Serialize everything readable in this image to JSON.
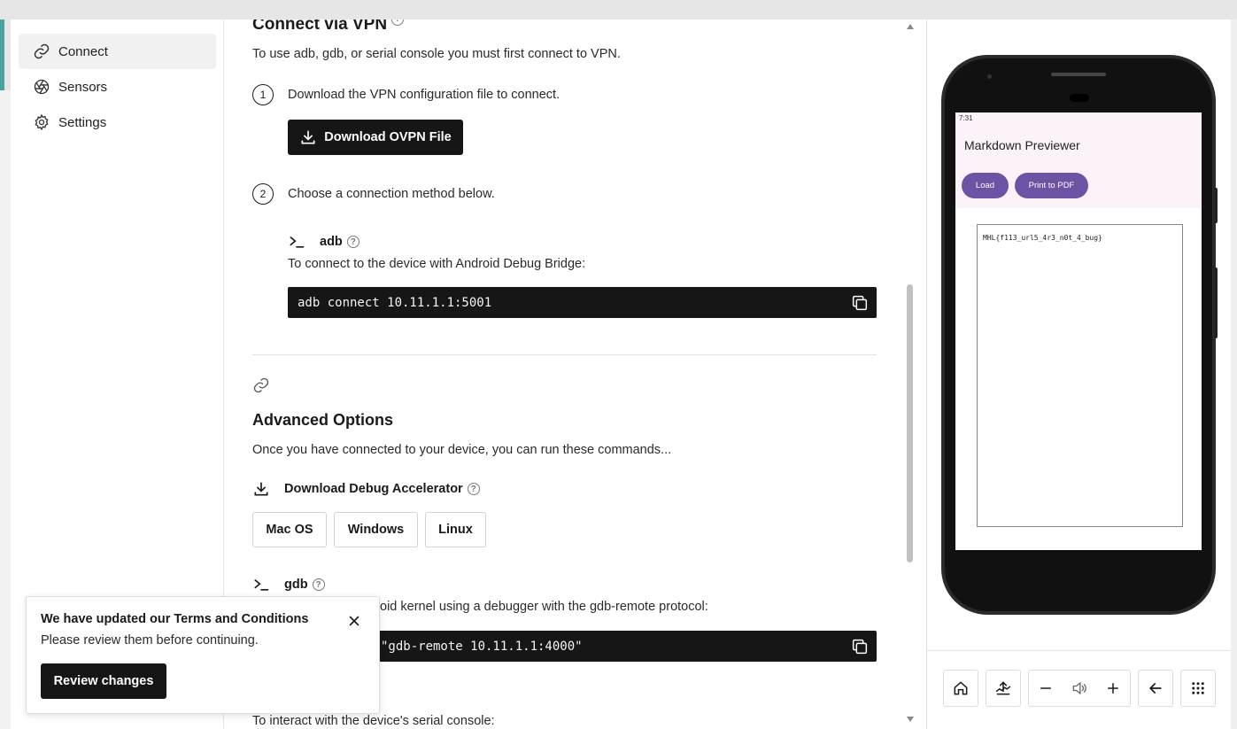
{
  "sidebar": {
    "items": [
      {
        "label": "Connect",
        "icon": "link-icon",
        "active": true
      },
      {
        "label": "Sensors",
        "icon": "aperture-icon",
        "active": false
      },
      {
        "label": "Settings",
        "icon": "gear-icon",
        "active": false
      }
    ]
  },
  "vpn": {
    "title": "Connect via VPN",
    "intro": "To use adb, gdb, or serial console you must first connect to VPN.",
    "step1_num": "1",
    "step1_text": "Download the VPN configuration file to connect.",
    "download_button": "Download OVPN File",
    "step2_num": "2",
    "step2_text": "Choose a connection method below.",
    "adb_label": "adb",
    "adb_desc": "To connect to the device with Android Debug Bridge:",
    "adb_command": "adb connect 10.11.1.1:5001"
  },
  "advanced": {
    "title": "Advanced Options",
    "intro": "Once you have connected to your device, you can run these commands...",
    "accelerator_label": "Download Debug Accelerator",
    "os_buttons": [
      "Mac OS",
      "Windows",
      "Linux"
    ],
    "gdb_label": "gdb",
    "gdb_desc_visible": "oid kernel using a debugger with the gdb-remote protocol:",
    "gdb_command_visible": "\"gdb-remote 10.11.1.1:4000\"",
    "serial_desc": "To interact with the device's serial console:"
  },
  "toast": {
    "title": "We have updated our Terms and Conditions",
    "body": "Please review them before continuing.",
    "button": "Review changes"
  },
  "device": {
    "status_time": "7:31",
    "app_title": "Markdown Previewer",
    "load_button": "Load",
    "print_button": "Print to PDF",
    "markdown_content": "MHL{f113_url5_4r3_n0t_4_bug}",
    "accent": "#6c53a4",
    "appbar_color": "#fcf3fa"
  },
  "controls": [
    "home-icon",
    "screenshot-icon",
    "volume-down-icon",
    "volume-icon",
    "volume-up-icon",
    "back-icon",
    "apps-grid-icon"
  ]
}
